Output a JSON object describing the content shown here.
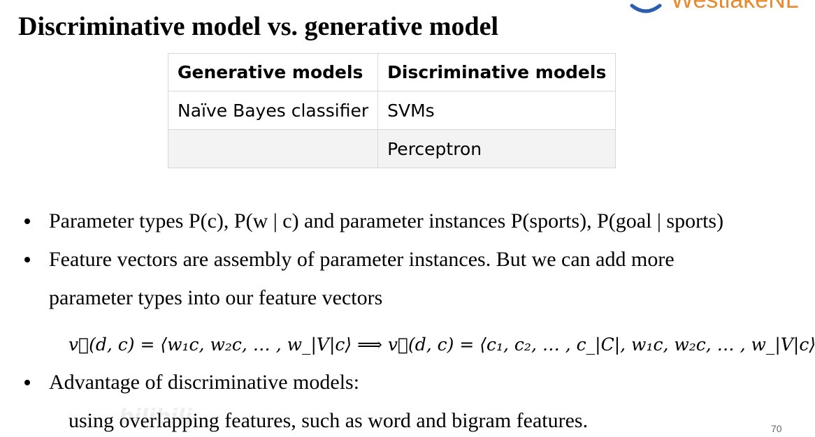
{
  "slide": {
    "title": "Discriminative model vs. generative model",
    "logo_text": "WestlakeNL",
    "page_number": "70",
    "watermark_text": "bilibili"
  },
  "table": {
    "headers": [
      "Generative models",
      "Discriminative models"
    ],
    "rows": [
      [
        "Naïve Bayes classifier",
        "SVMs"
      ],
      [
        "",
        "Perceptron"
      ]
    ]
  },
  "bullets": {
    "item1": "Parameter types P(c), P(w | c) and parameter instances P(sports), P(goal | sports)",
    "item2_line1": "Feature vectors are assembly of parameter instances. But we can add more",
    "item2_line2": "parameter types into our feature vectors",
    "formula": "v⃗(d, c) = ⟨w₁c, w₂c, … , w_|V|c⟩ ⟹ v⃗(d, c) = ⟨c₁, c₂, … , c_|C|, w₁c, w₂c, … , w_|V|c⟩",
    "item3": "Advantage of discriminative models:",
    "item3_sub": "using overlapping features, such as word and bigram  features."
  },
  "colors": {
    "logo_orange": "#e8892c",
    "logo_blue": "#2a5db0",
    "table_border": "#d8d8d8",
    "shaded_row": "#f3f3f3"
  },
  "icons": {
    "logo": "westlake-logo-icon"
  }
}
